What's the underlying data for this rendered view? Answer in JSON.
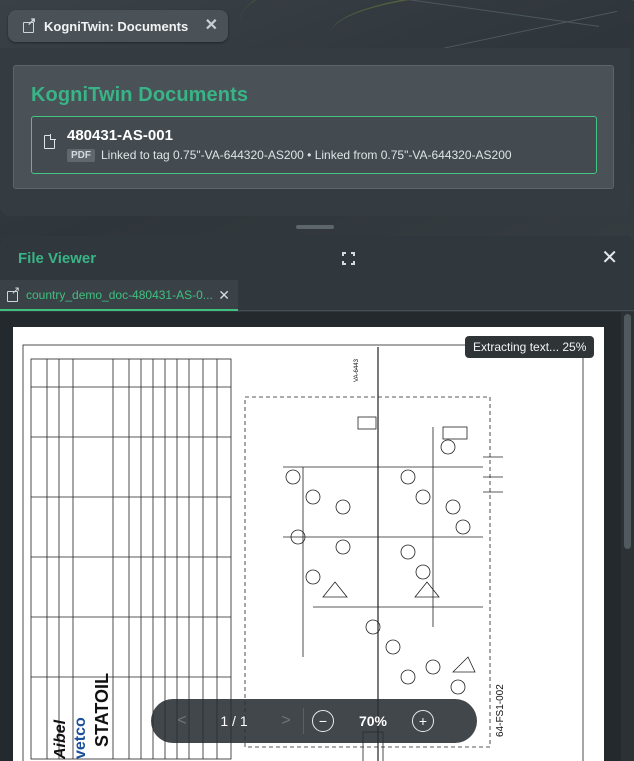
{
  "top_tab": {
    "label": "KogniTwin: Documents",
    "close": "✕"
  },
  "documents_panel": {
    "title": "KogniTwin Documents",
    "items": [
      {
        "name": "480431-AS-001",
        "type_badge": "PDF",
        "meta": "Linked to tag 0.75\"-VA-644320-AS200 • Linked from 0.75\"-VA-644320-AS200"
      }
    ]
  },
  "file_viewer": {
    "title": "File Viewer",
    "close": "✕",
    "tab": {
      "label": "country_demo_doc-480431-AS-0...",
      "close": "✕"
    },
    "extract_status": "Extracting text... 25%",
    "pager": {
      "prev": "<",
      "page_count": "1 / 1",
      "next": ">",
      "zoom_out": "−",
      "zoom_level": "70%",
      "zoom_in": "+"
    }
  },
  "drawing": {
    "company": "STATOIL",
    "company2": "vetco",
    "company3": "Aibel",
    "title_block_fragment": "64-FS1-002",
    "tag_text": "VA-6443"
  },
  "colors": {
    "accent_green": "#38b486",
    "tab_green": "#3fc07f"
  },
  "icons": [
    "external-link-icon",
    "close-icon",
    "file-icon",
    "fullscreen-icon"
  ]
}
